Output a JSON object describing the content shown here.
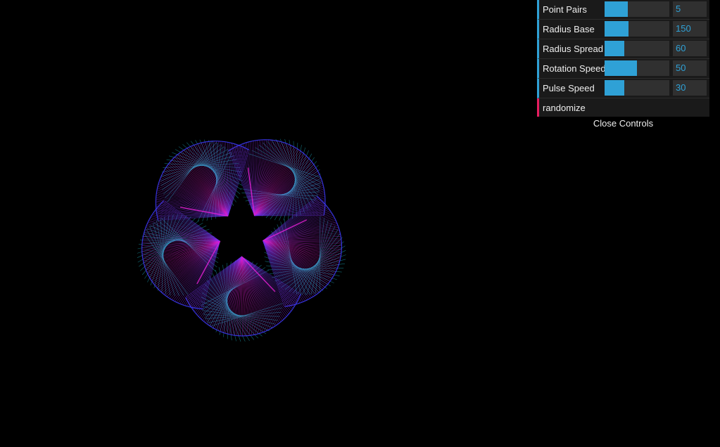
{
  "artwork": {
    "petal_count": 5,
    "colors": {
      "cyan": "#21c3d8",
      "blue": "#3c3cff",
      "violet": "#8a2be2",
      "magenta": "#e020d0"
    }
  },
  "controls": {
    "accent_color": "#2fa1d6",
    "button_accent_color": "#e61d5f",
    "items": [
      {
        "label": "Point Pairs",
        "value": "5",
        "fill": 0.36
      },
      {
        "label": "Radius Base",
        "value": "150",
        "fill": 0.37
      },
      {
        "label": "Radius Spread",
        "value": "60",
        "fill": 0.3
      },
      {
        "label": "Rotation Speed",
        "value": "50",
        "fill": 0.5
      },
      {
        "label": "Pulse Speed",
        "value": "30",
        "fill": 0.3
      }
    ],
    "randomize_label": "randomize",
    "close_label": "Close Controls"
  }
}
